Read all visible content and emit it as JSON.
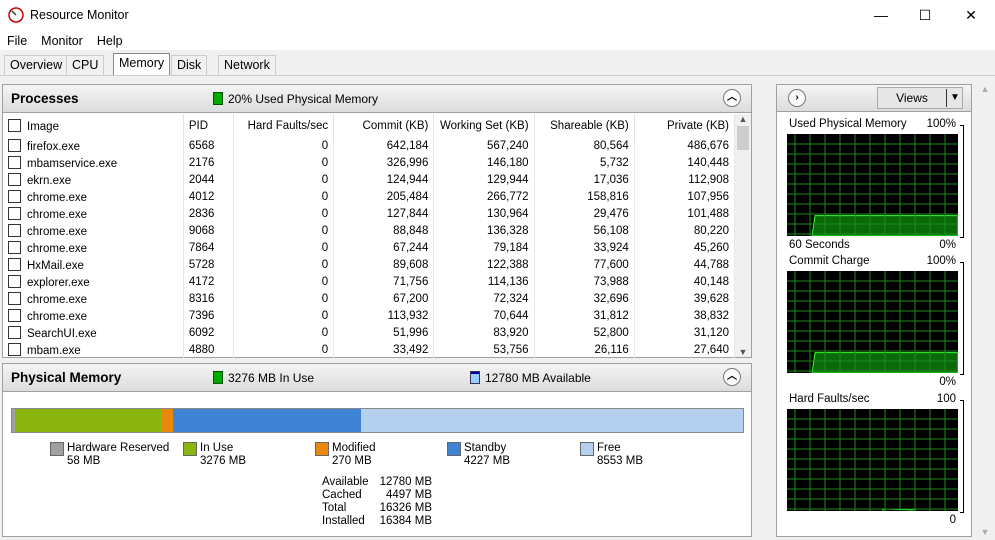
{
  "window": {
    "title": "Resource Monitor",
    "minimize": "—",
    "maximize": "☐",
    "close": "✕"
  },
  "menu": [
    "File",
    "Monitor",
    "Help"
  ],
  "tabs": [
    "Overview",
    "CPU",
    "Memory",
    "Disk",
    "Network"
  ],
  "active_tab": "Memory",
  "processes": {
    "title": "Processes",
    "indicator": "20% Used Physical Memory",
    "columns": [
      "Image",
      "PID",
      "Hard Faults/sec",
      "Commit (KB)",
      "Working Set (KB)",
      "Shareable (KB)",
      "Private (KB)"
    ],
    "sort_column": "Private (KB)",
    "rows": [
      [
        "firefox.exe",
        "6568",
        "0",
        "642,184",
        "567,240",
        "80,564",
        "486,676"
      ],
      [
        "mbamservice.exe",
        "2176",
        "0",
        "326,996",
        "146,180",
        "5,732",
        "140,448"
      ],
      [
        "ekrn.exe",
        "2044",
        "0",
        "124,944",
        "129,944",
        "17,036",
        "112,908"
      ],
      [
        "chrome.exe",
        "4012",
        "0",
        "205,484",
        "266,772",
        "158,816",
        "107,956"
      ],
      [
        "chrome.exe",
        "2836",
        "0",
        "127,844",
        "130,964",
        "29,476",
        "101,488"
      ],
      [
        "chrome.exe",
        "9068",
        "0",
        "88,848",
        "136,328",
        "56,108",
        "80,220"
      ],
      [
        "chrome.exe",
        "7864",
        "0",
        "67,244",
        "79,184",
        "33,924",
        "45,260"
      ],
      [
        "HxMail.exe",
        "5728",
        "0",
        "89,608",
        "122,388",
        "77,600",
        "44,788"
      ],
      [
        "explorer.exe",
        "4172",
        "0",
        "71,756",
        "114,136",
        "73,988",
        "40,148"
      ],
      [
        "chrome.exe",
        "8316",
        "0",
        "67,200",
        "72,324",
        "32,696",
        "39,628"
      ],
      [
        "chrome.exe",
        "7396",
        "0",
        "113,932",
        "70,644",
        "31,812",
        "38,832"
      ],
      [
        "SearchUI.exe",
        "6092",
        "0",
        "51,996",
        "83,920",
        "52,800",
        "31,120"
      ],
      [
        "mbam.exe",
        "4880",
        "0",
        "33,492",
        "53,756",
        "26,116",
        "27,640"
      ]
    ]
  },
  "physical_memory": {
    "title": "Physical Memory",
    "in_use_indicator": "3276 MB In Use",
    "available_indicator": "12780 MB Available",
    "legend": [
      {
        "label": "Hardware Reserved",
        "value": "58 MB",
        "mb": 58,
        "color": "#a0a0a0"
      },
      {
        "label": "In Use",
        "value": "3276 MB",
        "mb": 3276,
        "color": "#8ab40e"
      },
      {
        "label": "Modified",
        "value": "270 MB",
        "mb": 270,
        "color": "#e8890c"
      },
      {
        "label": "Standby",
        "value": "4227 MB",
        "mb": 4227,
        "color": "#3f84d4"
      },
      {
        "label": "Free",
        "value": "8553 MB",
        "mb": 8553,
        "color": "#b5cfee"
      }
    ],
    "summary": [
      {
        "label": "Available",
        "value": "12780 MB"
      },
      {
        "label": "Cached",
        "value": "4497 MB"
      },
      {
        "label": "Total",
        "value": "16326 MB"
      },
      {
        "label": "Installed",
        "value": "16384 MB"
      }
    ]
  },
  "right_pane": {
    "views_label": "Views",
    "graphs": [
      {
        "title": "Used Physical Memory",
        "max": "100%",
        "min": "0%",
        "footer": "60 Seconds",
        "level_percent": 20
      },
      {
        "title": "Commit Charge",
        "max": "100%",
        "min": "0%",
        "level_percent": 20
      },
      {
        "title": "Hard Faults/sec",
        "max": "100",
        "min": "0",
        "level_percent": 0
      }
    ]
  }
}
